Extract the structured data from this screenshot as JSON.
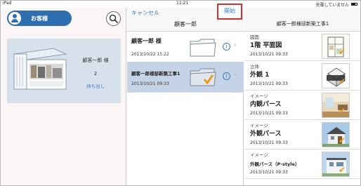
{
  "statusbar": {
    "device": "iPad",
    "time": "11:21",
    "charging": "充電していません"
  },
  "panel1": {
    "customer_button": "お客様",
    "card": {
      "customer_name": "顧客一郎 様",
      "count": "2",
      "action": "持ち出し"
    }
  },
  "panel2": {
    "cancel": "キャンセル",
    "start": "開始",
    "title": "顧客一郎",
    "rows": [
      {
        "name": "顧客一郎 様",
        "date": "2013/10/22 15:22",
        "selected": false
      },
      {
        "name": "顧客一郎様邸新築工事1",
        "date": "2013/10/21 09:33",
        "selected": true
      }
    ]
  },
  "panel3": {
    "title": "顧客一郎様邸新築工事1",
    "items": [
      {
        "category": "図面",
        "title": "1階 平面図",
        "date": "2013/10/21 09:33",
        "thumb": "floorplan"
      },
      {
        "category": "立体",
        "title": "外観 1",
        "date": "2013/10/21 09:33",
        "thumb": "3d"
      },
      {
        "category": "イメージ",
        "title": "内観パース",
        "date": "2013/10/21 09:33",
        "thumb": "interior"
      },
      {
        "category": "イメージ",
        "title": "外観パース",
        "date": "2013/10/21 09:33",
        "thumb": "exterior"
      },
      {
        "category": "イメージ",
        "title": "外観パース（P-style）",
        "date": "2013/10/21 09:33",
        "thumb": "exterior2"
      }
    ]
  },
  "colors": {
    "accent": "#2f6fb0",
    "link": "#3a7bc4",
    "highlight": "#c5d3e6",
    "check": "#e89a1a",
    "start_border": "#d23030"
  }
}
